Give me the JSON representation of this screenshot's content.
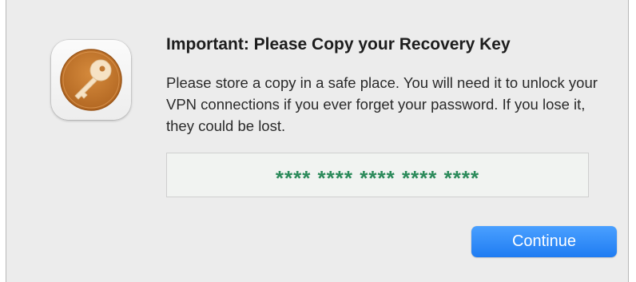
{
  "dialog": {
    "icon": "key-icon",
    "title": "Important: Please Copy your Recovery Key",
    "message": "Please store a copy in a safe place. You will need it to unlock your VPN connections if you ever forget your password. If you lose it, they could be lost.",
    "recovery_key": "**** **** **** **** ****",
    "continue_label": "Continue"
  },
  "colors": {
    "accent": "#1f7cf2",
    "key_text": "#2b8a5a",
    "icon_fill": "#c07a33"
  }
}
